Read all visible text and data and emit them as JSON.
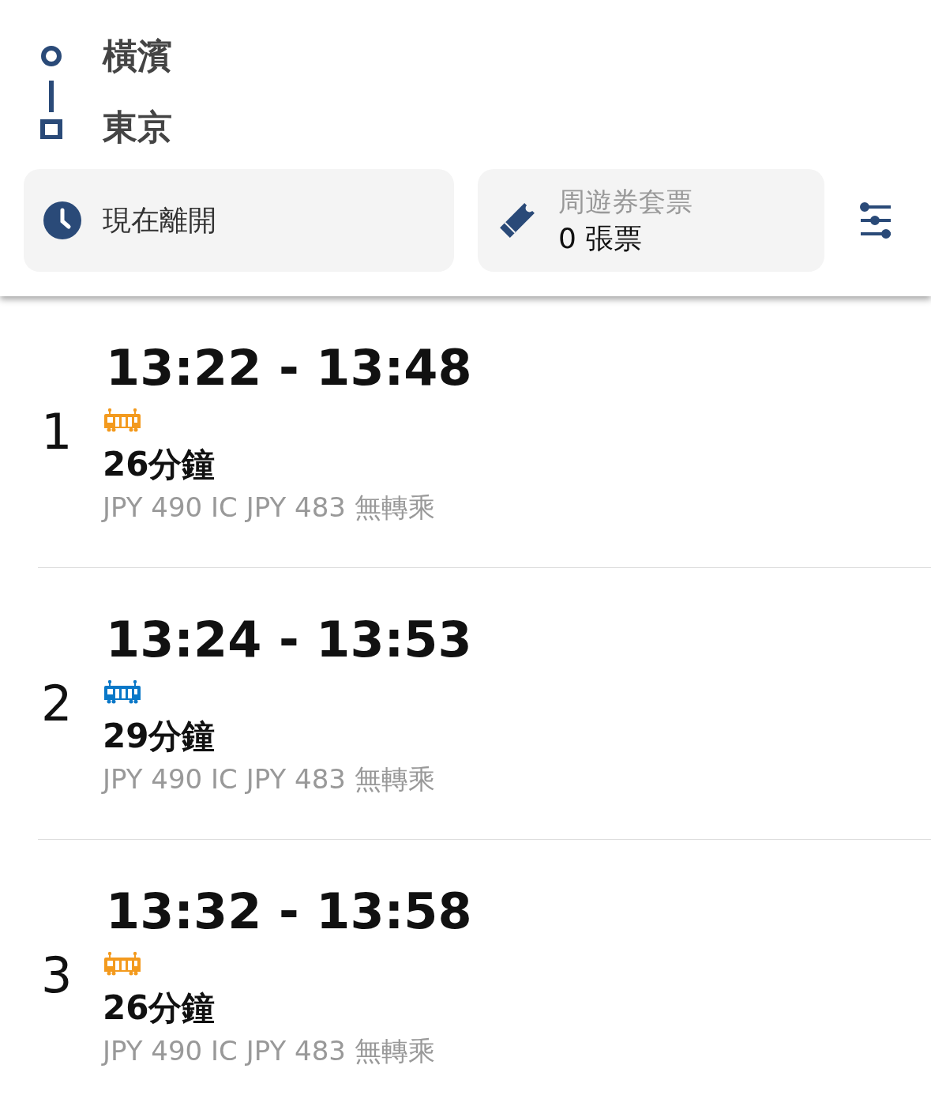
{
  "route": {
    "origin": "橫濱",
    "destination": "東京"
  },
  "departure": {
    "label": "現在離開"
  },
  "passes": {
    "label": "周遊券套票",
    "value": "0 張票"
  },
  "results": [
    {
      "index": "1",
      "times": "13:22 - 13:48",
      "color": "#f39a1e",
      "duration": "26分鐘",
      "fare": "JPY 490 IC JPY 483 無轉乘"
    },
    {
      "index": "2",
      "times": "13:24 - 13:53",
      "color": "#0a78c8",
      "duration": "29分鐘",
      "fare": "JPY 490 IC JPY 483 無轉乘"
    },
    {
      "index": "3",
      "times": "13:32 - 13:58",
      "color": "#f39a1e",
      "duration": "26分鐘",
      "fare": "JPY 490 IC JPY 483 無轉乘"
    }
  ]
}
